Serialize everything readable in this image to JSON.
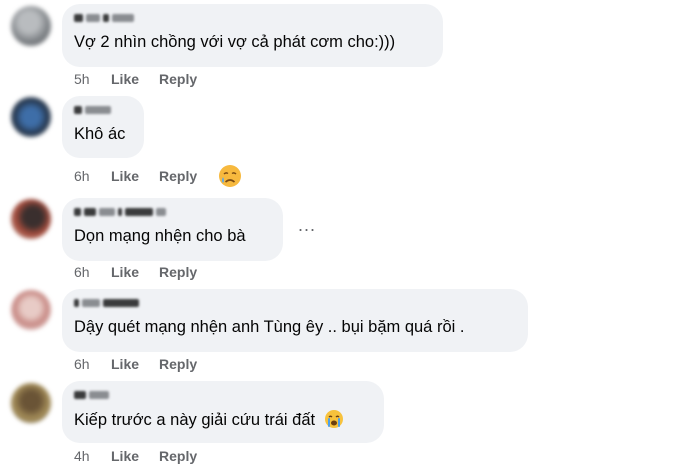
{
  "comments": [
    {
      "text": "Vợ 2 nhìn chồng với vợ cả phát cơm cho:)))",
      "time": "5h",
      "like": "Like",
      "reply": "Reply"
    },
    {
      "text": "Khô ác",
      "time": "6h",
      "like": "Like",
      "reply": "Reply",
      "reaction": "sad-emoji"
    },
    {
      "text": "Dọn mạng nhện cho bà",
      "time": "6h",
      "like": "Like",
      "reply": "Reply",
      "more": "..."
    },
    {
      "text": "Dậy quét mạng nhện anh Tùng êy .. bụi bặm quá rồi .",
      "time": "6h",
      "like": "Like",
      "reply": "Reply"
    },
    {
      "text": "Kiếp trước a này giải cứu trái đất",
      "time": "4h",
      "like": "Like",
      "reply": "Reply",
      "inline_emoji": "crying-emoji"
    }
  ],
  "colors": {
    "bubble": "#f0f2f5",
    "text": "#050505",
    "meta": "#65676b"
  }
}
